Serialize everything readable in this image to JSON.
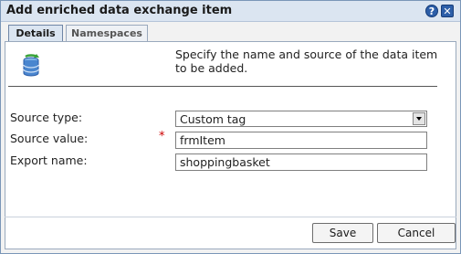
{
  "dialog": {
    "title": "Add enriched data exchange item",
    "help_glyph": "?",
    "close_glyph": "✕"
  },
  "tabs": [
    {
      "label": "Details",
      "active": true
    },
    {
      "label": "Namespaces",
      "active": false
    }
  ],
  "header": {
    "icon": "database-icon",
    "description": "Specify the name and source of the data item to be added."
  },
  "form": {
    "source_type": {
      "label": "Source type:",
      "value": "Custom tag"
    },
    "source_value": {
      "label": "Source value:",
      "required_marker": "*",
      "value": "frmItem"
    },
    "export_name": {
      "label": "Export name:",
      "value": "shoppingbasket"
    }
  },
  "buttons": {
    "save": "Save",
    "cancel": "Cancel"
  },
  "colors": {
    "title_bar": "#dbe5f1",
    "accent": "#2c5ea8",
    "required": "#cc0000"
  }
}
